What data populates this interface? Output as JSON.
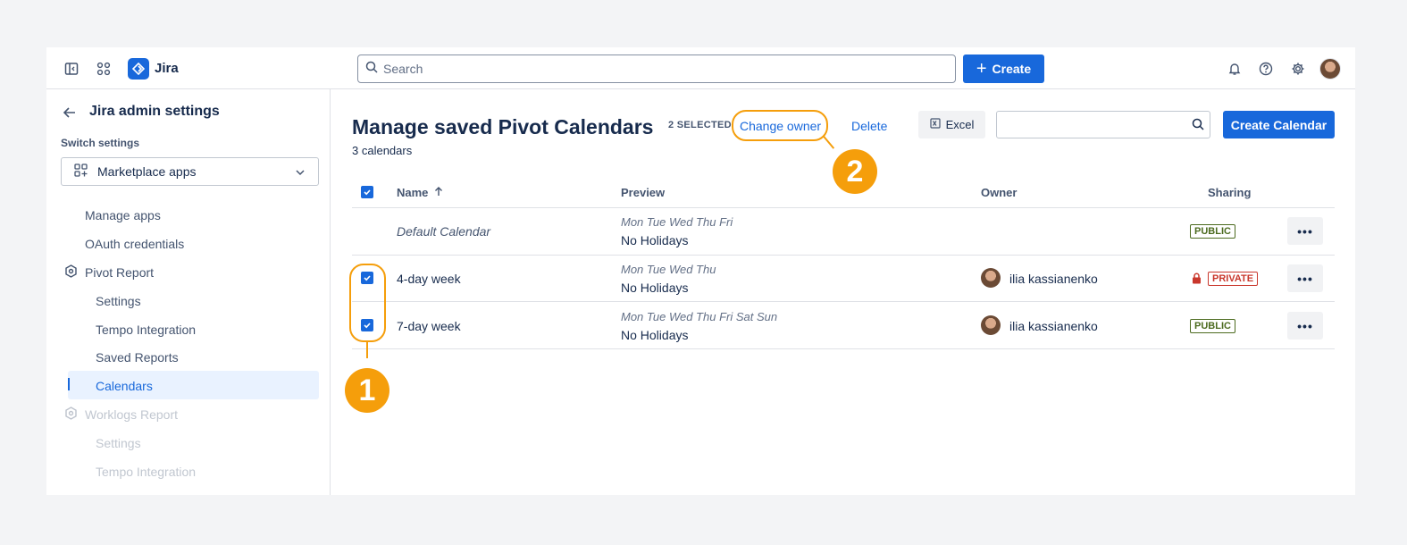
{
  "topbar": {
    "brand": "Jira",
    "search_placeholder": "Search",
    "create_label": "Create"
  },
  "sidebar": {
    "title": "Jira admin settings",
    "switch_label": "Switch settings",
    "switch_value": "Marketplace apps",
    "items": [
      {
        "label": "Manage apps"
      },
      {
        "label": "OAuth credentials"
      },
      {
        "label": "Pivot Report"
      },
      {
        "label": "Settings"
      },
      {
        "label": "Tempo Integration"
      },
      {
        "label": "Saved Reports"
      },
      {
        "label": "Calendars"
      },
      {
        "label": "Worklogs Report"
      },
      {
        "label": "Settings"
      },
      {
        "label": "Tempo Integration"
      }
    ]
  },
  "main": {
    "title": "Manage saved Pivot Calendars",
    "count": "3 calendars",
    "selected": "2 SELECTED",
    "change_owner": "Change owner",
    "delete": "Delete",
    "excel": "Excel",
    "create_calendar": "Create Calendar",
    "headers": {
      "name": "Name",
      "preview": "Preview",
      "owner": "Owner",
      "sharing": "Sharing"
    },
    "rows": [
      {
        "name": "Default Calendar",
        "days": "Mon Tue Wed Thu Fri",
        "holidays": "No Holidays",
        "owner": "",
        "sharing": "PUBLIC",
        "checked": false
      },
      {
        "name": "4-day week",
        "days": "Mon Tue Wed Thu",
        "holidays": "No Holidays",
        "owner": "ilia kassianenko",
        "sharing": "PRIVATE",
        "checked": true
      },
      {
        "name": "7-day week",
        "days": "Mon Tue Wed Thu Fri Sat Sun",
        "holidays": "No Holidays",
        "owner": "ilia kassianenko",
        "sharing": "PUBLIC",
        "checked": true
      }
    ],
    "more_label": "•••"
  },
  "callouts": [
    "1",
    "2"
  ],
  "colors": {
    "accent": "#1868db",
    "callout": "#f59e0b",
    "public": "#4c6b1f",
    "private": "#c9372c"
  }
}
